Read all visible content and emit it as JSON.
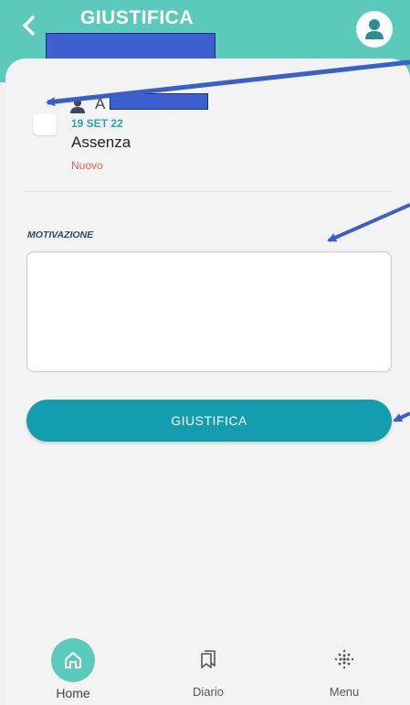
{
  "header": {
    "title": "GIUSTIFICA",
    "back_icon": "chevron-left-icon",
    "profile_icon": "user-avatar-icon"
  },
  "event": {
    "student_name": "A",
    "date": "19 SET 22",
    "type": "Assenza",
    "status": "Nuovo"
  },
  "form": {
    "motivazione_label": "MOTIVAZIONE",
    "motivazione_value": "",
    "submit_label": "GIUSTIFICA"
  },
  "nav": {
    "items": [
      {
        "label": "Home",
        "icon": "home-icon",
        "active": true
      },
      {
        "label": "Diario",
        "icon": "bookmarks-icon",
        "active": false
      },
      {
        "label": "Menu",
        "icon": "dots-grid-icon",
        "active": false
      }
    ]
  },
  "colors": {
    "header_bg": "#5ccabb",
    "button_bg": "#139dae",
    "date_text": "#2aa6b6",
    "status_text": "#e06456",
    "annotation_arrow": "#3a5fc8",
    "redaction": "#3d5fcf"
  }
}
